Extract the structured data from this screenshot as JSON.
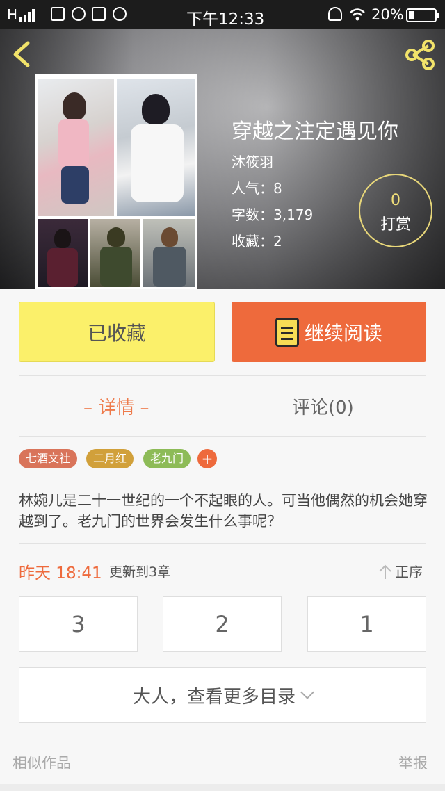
{
  "status_bar": {
    "network": "H",
    "time": "下午12:33",
    "battery": "20%"
  },
  "header": {
    "back_icon": "chevron-left-icon",
    "share_icon": "share-icon"
  },
  "book": {
    "title": "穿越之注定遇见你",
    "author": "沐筱羽",
    "popularity": "人气：8",
    "word_count": "字数：3,179",
    "favorites": "收藏：2"
  },
  "tip": {
    "count": "0",
    "label": "打赏"
  },
  "actions": {
    "favorite_label": "已收藏",
    "read_label": "继续阅读"
  },
  "tabs": {
    "detail": "– 详情 –",
    "comments": "评论(0)"
  },
  "tags": [
    "七酒文社",
    "二月红",
    "老九门",
    "+"
  ],
  "description": "林婉儿是二十一世纪的一个不起眼的人。可当他偶然的机会她穿越到了。老九门的世界会发生什么事呢？",
  "update": {
    "time": "昨天 18:41",
    "text": "更新到3章",
    "order": "正序"
  },
  "chapters": [
    "3",
    "2",
    "1"
  ],
  "more_catalog": "大人，查看更多目录",
  "footer": {
    "similar": "相似作品",
    "report": "举报"
  },
  "colors": {
    "accent": "#ee6a3c",
    "favorite_bg": "#fbf06a",
    "tip_ring": "#e8d77a"
  }
}
